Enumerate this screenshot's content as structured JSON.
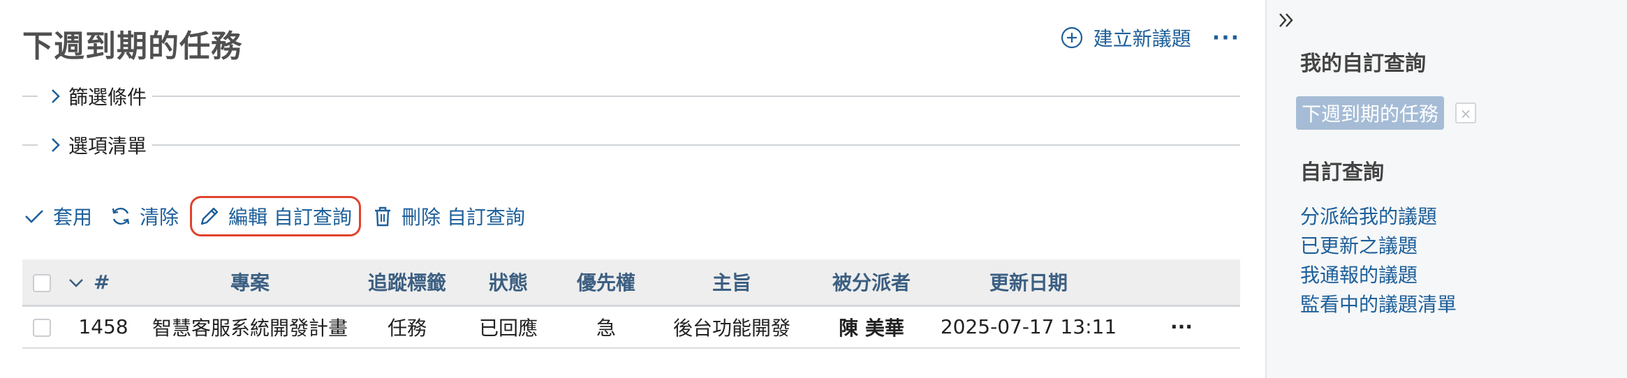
{
  "page": {
    "title": "下週到期的任務",
    "new_issue_label": "建立新議題",
    "more_label": "···"
  },
  "fieldsets": {
    "filters_label": "篩選條件",
    "options_label": "選項清單"
  },
  "toolbar": {
    "apply_label": "套用",
    "clear_label": "清除",
    "edit_label": "編輯 自訂查詢",
    "delete_label": "刪除 自訂查詢"
  },
  "table": {
    "headers": {
      "id": "#",
      "project": "專案",
      "tracker": "追蹤標籤",
      "status": "狀態",
      "priority": "優先權",
      "subject": "主旨",
      "assignee": "被分派者",
      "updated": "更新日期"
    },
    "rows": [
      {
        "id": "1458",
        "project": "智慧客服系統開發計畫",
        "tracker": "任務",
        "status": "已回應",
        "priority": "急",
        "subject": "後台功能開發",
        "assignee": "陳 美華",
        "updated": "2025-07-17 13:11",
        "more": "···"
      }
    ]
  },
  "sidebar": {
    "my_queries_heading": "我的自訂查詢",
    "current_query": "下週到期的任務",
    "close_glyph": "×",
    "custom_queries_heading": "自訂查詢",
    "queries": [
      "分派給我的議題",
      "已更新之議題",
      "我通報的議題",
      "監看中的議題清單"
    ]
  },
  "colors": {
    "link": "#1d5f9a",
    "highlight_border": "#e0432d",
    "tag_background": "#a6bcd6",
    "sidebar_background": "#f6f7f8",
    "table_header_background": "#eeeeee"
  }
}
